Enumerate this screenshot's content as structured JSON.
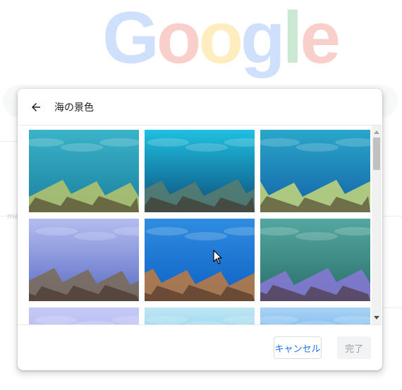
{
  "background": {
    "logo_letters": [
      {
        "char": "G",
        "color": "#4285f4"
      },
      {
        "char": "o",
        "color": "#ea4335"
      },
      {
        "char": "o",
        "color": "#fbbc05"
      },
      {
        "char": "g",
        "color": "#4285f4"
      },
      {
        "char": "l",
        "color": "#34a853"
      },
      {
        "char": "e",
        "color": "#ea4335"
      }
    ],
    "ghost_text": "ma"
  },
  "dialog": {
    "title": "海の景色",
    "back_icon": "arrow-left-icon",
    "cancel_label": "キャンセル",
    "done_label": "完了",
    "accent_color": "#1a73e8"
  },
  "tiles": [
    {
      "id": "underwater-1",
      "top": "#3ab4c8",
      "bottom": "#1b7fa0",
      "reef": "#b9c46a"
    },
    {
      "id": "underwater-2",
      "top": "#1fc0e0",
      "bottom": "#0d4d7a",
      "reef": "#5a7d6e"
    },
    {
      "id": "underwater-3",
      "top": "#2aa7c9",
      "bottom": "#1462a8",
      "reef": "#c8d878"
    },
    {
      "id": "underwater-4",
      "top": "#b4bdf0",
      "bottom": "#5a6cc4",
      "reef": "#7a6a55"
    },
    {
      "id": "underwater-5",
      "top": "#2f8de0",
      "bottom": "#0e60c4",
      "reef": "#c07a3e"
    },
    {
      "id": "underwater-6",
      "top": "#53a8a0",
      "bottom": "#2b6d6a",
      "reef": "#8a78d8"
    },
    {
      "id": "underwater-7",
      "top": "#c5c9f5",
      "bottom": "#9aa4ee",
      "reef": "#9aa4ee"
    },
    {
      "id": "underwater-8",
      "top": "#bfe8f5",
      "bottom": "#3aa5d8",
      "reef": "#3aa5d8"
    },
    {
      "id": "underwater-9",
      "top": "#a8d4f5",
      "bottom": "#1f7ad8",
      "reef": "#1f7ad8"
    }
  ]
}
